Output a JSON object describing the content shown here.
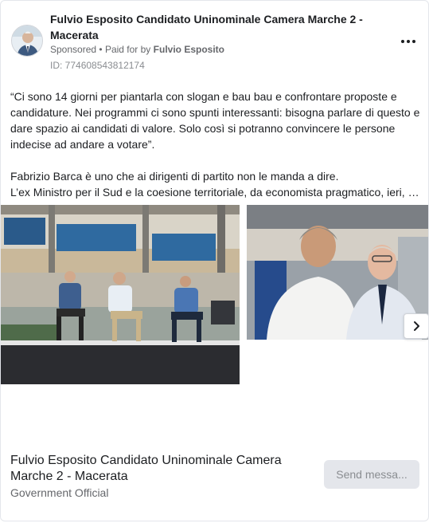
{
  "ad": {
    "page_name": "Fulvio Esposito Candidato Uninominale Camera Marche 2 - Macerata",
    "sponsored": "Sponsored",
    "separator": "•",
    "paid_for_by": "Paid for by",
    "funder": "Fulvio Esposito",
    "ad_id": "ID: 774608543812174"
  },
  "body": {
    "paragraph1": "“Ci sono 14 giorni per piantarla con slogan e bau bau e confrontare proposte e candidature. Nei programmi ci sono spunti interessanti: bisogna parlare di questo e dare spazio ai candidati di valore. Solo così si potranno convincere le persone indecise ad andare a votare”.",
    "paragraph2_line1": "Fabrizio Barca è uno che ai dirigenti di partito non le manda a dire.",
    "paragraph2_line2": "L’ex Ministro per il Sud e la coesione territoriale, da economista pragmatico, ieri, s..."
  },
  "footer": {
    "title": "Fulvio Esposito Candidato Uninominale Camera Marche 2 - Macerata",
    "subtitle": "Government Official",
    "cta": "Send messa..."
  },
  "icons": {
    "more": "more-options-icon",
    "next": "chevron-right-icon"
  },
  "colors": {
    "text_primary": "#1c1e21",
    "text_secondary": "#65676b",
    "button_bg": "#e4e6eb"
  }
}
